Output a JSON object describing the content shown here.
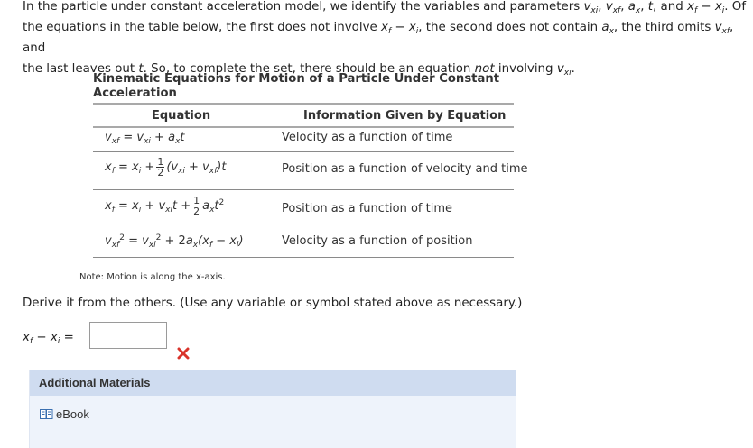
{
  "intro": {
    "line1_a": "In the particle under constant acceleration model, we identify the variables and parameters ",
    "line1_b": ", and ",
    "line1_c": ". Of",
    "line2_a": "the equations in the table below, the first does not involve ",
    "line2_b": ", the second does not contain ",
    "line2_c": ", the third omits ",
    "line2_d": ", and",
    "line3_a": "the last leaves out ",
    "line3_b": ". So, to complete the set, there should be an equation ",
    "line3_not": "not",
    "line3_c": " involving "
  },
  "table": {
    "title": "Kinematic Equations for Motion of a Particle Under Constant Acceleration",
    "col_equation": "Equation",
    "col_info": "Information Given by Equation",
    "rows_info": [
      "Velocity as a function of time",
      "Position as a function of velocity and time",
      "Position as a function of time",
      "Velocity as a function of position"
    ]
  },
  "note": "Note: Motion is along the x-axis.",
  "derive_text": "Derive it from the others. (Use any variable or symbol stated above as necessary.)",
  "answer": {
    "value": "",
    "status": "incorrect"
  },
  "materials": {
    "title": "Additional Materials",
    "ebook_label": "eBook"
  }
}
